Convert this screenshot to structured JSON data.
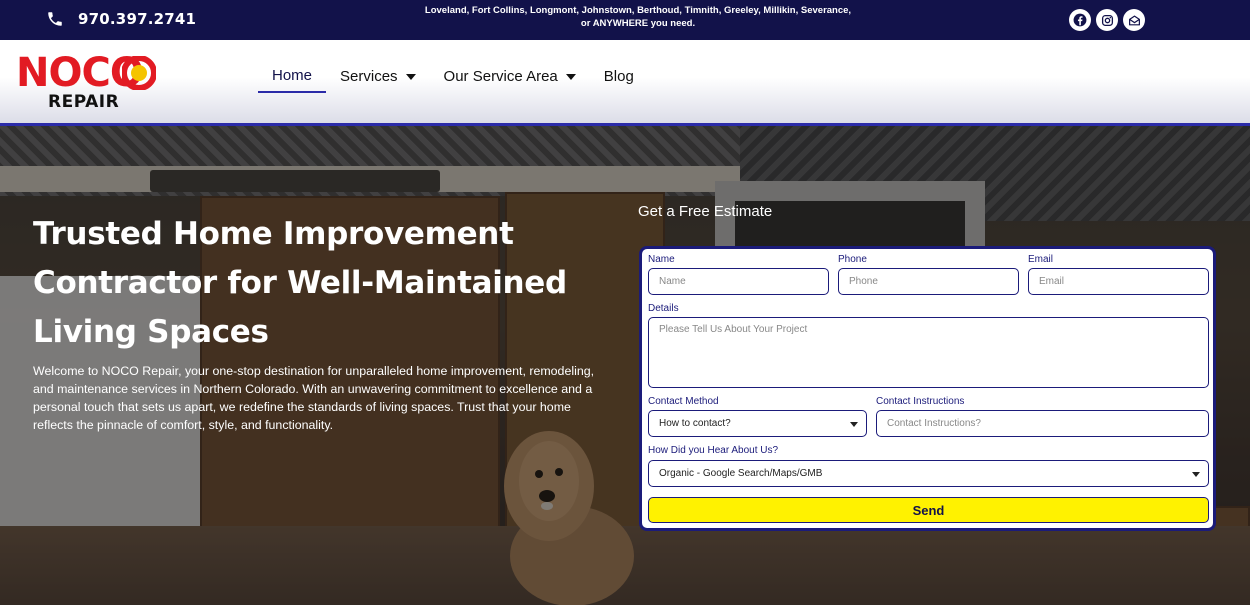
{
  "topbar": {
    "phone": "970.397.2741",
    "service_areas_line1": "Loveland, Fort Collins, Longmont, Johnstown, Berthoud, Timnith, Greeley, Millikin, Severance,",
    "service_areas_line2": "or ANYWHERE you need.",
    "social_icons": [
      "facebook-icon",
      "instagram-icon",
      "email-icon"
    ]
  },
  "header": {
    "logo_top": "NOCO",
    "logo_bottom": "REPAIR",
    "nav": [
      {
        "label": "Home",
        "active": true
      },
      {
        "label": "Services",
        "dropdown": true
      },
      {
        "label": "Our Service Area",
        "dropdown": true
      },
      {
        "label": "Blog"
      }
    ]
  },
  "hero": {
    "title": "Trusted Home Improvement Contractor for Well-Maintained Living Spaces",
    "intro": "Welcome to NOCO Repair, your one-stop destination for unparalleled home improvement, remodeling, and maintenance services in Northern Colorado. With an unwavering commitment to excellence and a personal touch that sets us apart, we redefine the standards of living spaces. Trust that your home reflects the pinnacle of comfort, style, and functionality."
  },
  "form": {
    "heading": "Get a Free Estimate",
    "name_label": "Name",
    "name_placeholder": "Name",
    "phone_label": "Phone",
    "phone_placeholder": "Phone",
    "email_label": "Email",
    "email_placeholder": "Email",
    "details_label": "Details",
    "details_placeholder": "Please Tell Us About Your Project",
    "contact_method_label": "Contact Method",
    "contact_method_value": "How to contact?",
    "contact_instructions_label": "Contact Instructions",
    "contact_instructions_placeholder": "Contact Instructions?",
    "heard_label": "How Did you Hear About Us?",
    "heard_value": "Organic - Google Search/Maps/GMB",
    "send_label": "Send"
  },
  "colors": {
    "navy": "#12124a",
    "brand_red": "#e21b23",
    "send_yellow": "#fff200"
  }
}
